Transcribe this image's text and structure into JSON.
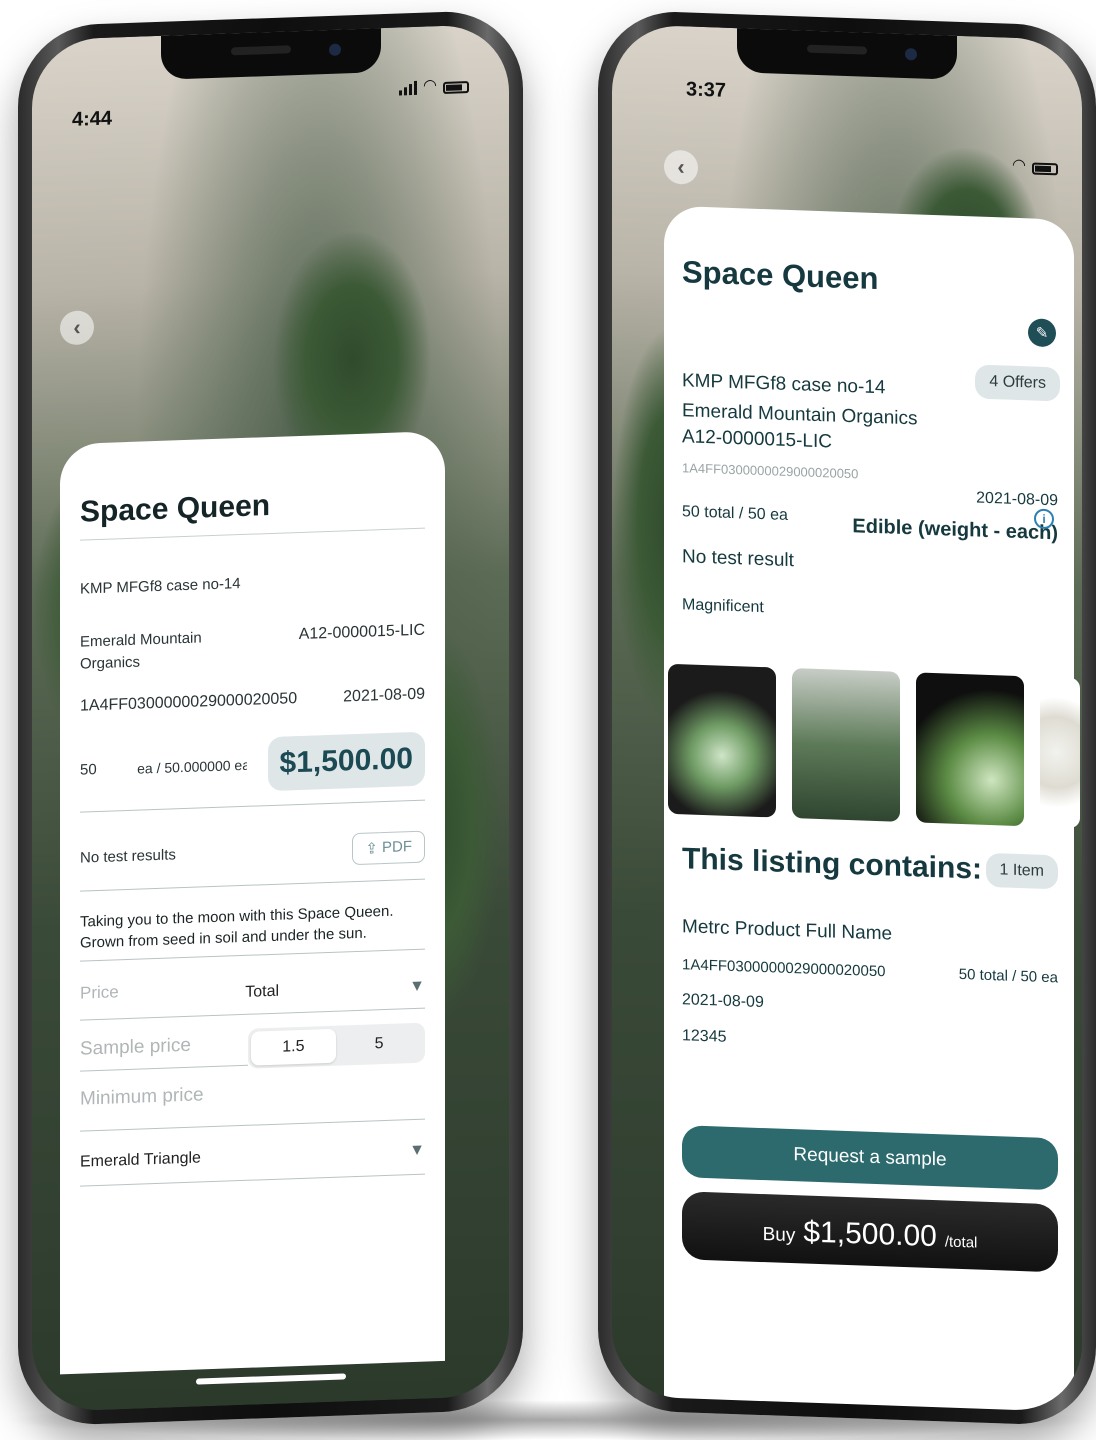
{
  "left": {
    "status_time": "4:44",
    "title": "Space Queen",
    "product_line": "KMP MFGf8 case no-14",
    "company": "Emerald Mountain Organics",
    "license": "A12-0000015-LIC",
    "package_id": "1A4FF0300000029000020050",
    "date": "2021-08-09",
    "quantity": "50",
    "unit_line": "ea / 50.000000 ea",
    "price": "$1,500.00",
    "test_results": "No test results",
    "pdf_label": "PDF",
    "description": "Taking you to the moon with this Space Queen. Grown from seed in soil and under the sun.",
    "price_label": "Price",
    "price_type": "Total",
    "sample_price_label": "Sample price",
    "sample_options": [
      "1.5",
      "5"
    ],
    "minimum_price_label": "Minimum price",
    "region": "Emerald Triangle"
  },
  "right": {
    "status_time": "3:37",
    "title": "Space Queen",
    "offers": "4 Offers",
    "product_line": "KMP MFGf8 case no-14",
    "company": "Emerald Mountain Organics",
    "license": "A12-0000015-LIC",
    "package_id": "1A4FF0300000029000020050",
    "date": "2021-08-09",
    "totals": "50 total / 50 ea",
    "category": "Edible (weight - each)",
    "test_result": "No test result",
    "tagline": "Magnificent",
    "listing_title": "This listing contains:",
    "items_count": "1 Item",
    "item": {
      "name": "Metrc Product Full Name",
      "package_id": "1A4FF0300000029000020050",
      "totals": "50 total / 50 ea",
      "date": "2021-08-09",
      "code": "12345"
    },
    "request_label": "Request a sample",
    "buy_word": "Buy",
    "buy_amount": "$1,500.00",
    "buy_suffix": "/total"
  },
  "icons": {
    "back": "chevron-left-icon",
    "edit": "pencil-icon",
    "info": "info-icon",
    "pdf": "cloud-upload-icon",
    "caret": "triangle-down-icon"
  },
  "colors": {
    "accent_teal": "#2c6a6e",
    "dark_teal_text": "#15393f",
    "pill_bg": "#dfe6e8",
    "buy_bg": "#111111"
  }
}
